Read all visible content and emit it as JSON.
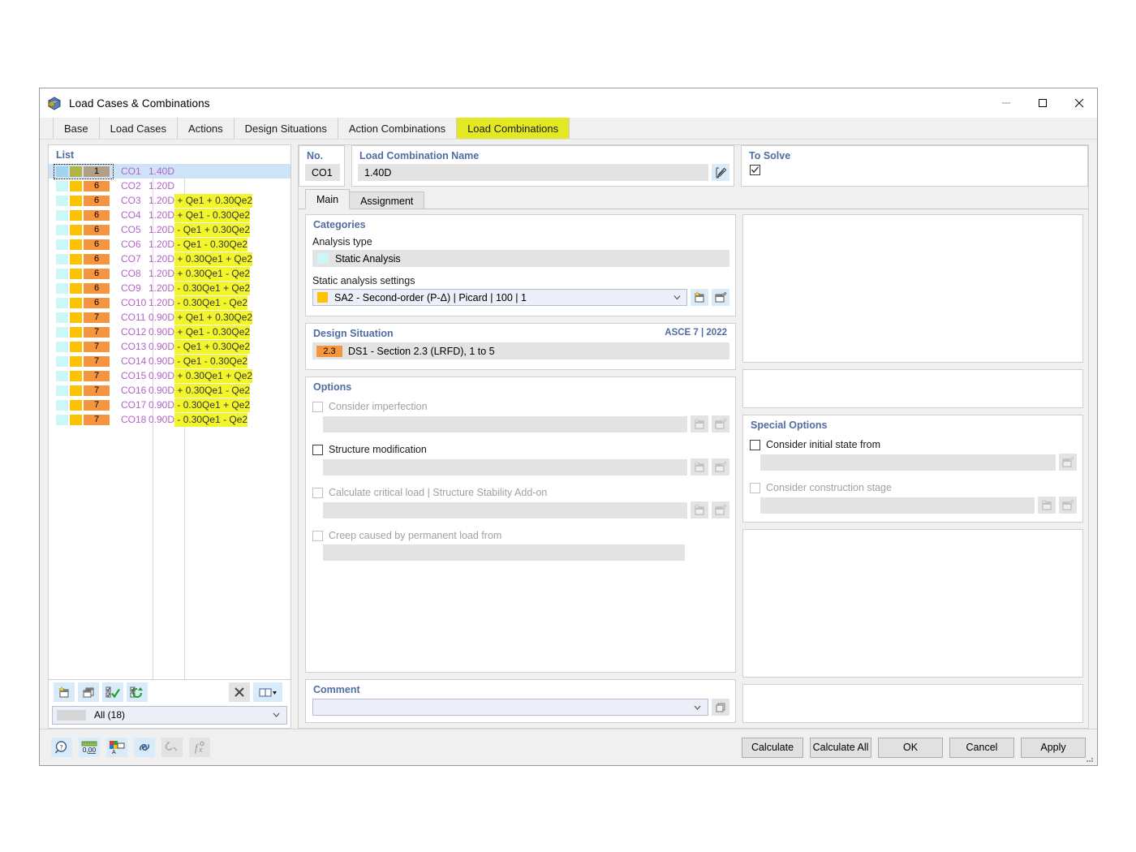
{
  "window": {
    "title": "Load Cases & Combinations",
    "minimize": "–",
    "maximize": "□",
    "close": "✕"
  },
  "tabs": [
    {
      "label": "Base",
      "active": false
    },
    {
      "label": "Load Cases",
      "active": false
    },
    {
      "label": "Actions",
      "active": false
    },
    {
      "label": "Design Situations",
      "active": false
    },
    {
      "label": "Action Combinations",
      "active": false
    },
    {
      "label": "Load Combinations",
      "active": true
    }
  ],
  "list": {
    "header": "List",
    "rows": [
      {
        "badge": "1",
        "no": "CO1",
        "base": "1.40D",
        "formula": "",
        "selected": true
      },
      {
        "badge": "6",
        "no": "CO2",
        "base": "1.20D",
        "formula": "",
        "selected": false
      },
      {
        "badge": "6",
        "no": "CO3",
        "base": "1.20D",
        "formula": "+ Qe1 + 0.30Qe2",
        "selected": false
      },
      {
        "badge": "6",
        "no": "CO4",
        "base": "1.20D",
        "formula": "+ Qe1 - 0.30Qe2",
        "selected": false
      },
      {
        "badge": "6",
        "no": "CO5",
        "base": "1.20D",
        "formula": "- Qe1 + 0.30Qe2",
        "selected": false
      },
      {
        "badge": "6",
        "no": "CO6",
        "base": "1.20D",
        "formula": "- Qe1 - 0.30Qe2",
        "selected": false
      },
      {
        "badge": "6",
        "no": "CO7",
        "base": "1.20D",
        "formula": "+ 0.30Qe1 + Qe2",
        "selected": false
      },
      {
        "badge": "6",
        "no": "CO8",
        "base": "1.20D",
        "formula": "+ 0.30Qe1 - Qe2",
        "selected": false
      },
      {
        "badge": "6",
        "no": "CO9",
        "base": "1.20D",
        "formula": "- 0.30Qe1 + Qe2",
        "selected": false
      },
      {
        "badge": "6",
        "no": "CO10",
        "base": "1.20D",
        "formula": "- 0.30Qe1 - Qe2",
        "selected": false
      },
      {
        "badge": "7",
        "no": "CO11",
        "base": "0.90D",
        "formula": "+ Qe1 + 0.30Qe2",
        "selected": false
      },
      {
        "badge": "7",
        "no": "CO12",
        "base": "0.90D",
        "formula": "+ Qe1 - 0.30Qe2",
        "selected": false
      },
      {
        "badge": "7",
        "no": "CO13",
        "base": "0.90D",
        "formula": "- Qe1 + 0.30Qe2",
        "selected": false
      },
      {
        "badge": "7",
        "no": "CO14",
        "base": "0.90D",
        "formula": "- Qe1 - 0.30Qe2",
        "selected": false
      },
      {
        "badge": "7",
        "no": "CO15",
        "base": "0.90D",
        "formula": "+ 0.30Qe1 + Qe2",
        "selected": false
      },
      {
        "badge": "7",
        "no": "CO16",
        "base": "0.90D",
        "formula": "+ 0.30Qe1 - Qe2",
        "selected": false
      },
      {
        "badge": "7",
        "no": "CO17",
        "base": "0.90D",
        "formula": "- 0.30Qe1 + Qe2",
        "selected": false
      },
      {
        "badge": "7",
        "no": "CO18",
        "base": "0.90D",
        "formula": "- 0.30Qe1 - Qe2",
        "selected": false
      }
    ],
    "toolbar": {
      "new": "new-icon",
      "copy": "copy-icon",
      "select_all": "select-all-icon",
      "refresh_select": "refresh-selection-icon",
      "delete": "✕",
      "view": "columns-icon",
      "view_caret": "▾"
    },
    "filter": {
      "value": "All (18)"
    }
  },
  "detail": {
    "no": {
      "label": "No.",
      "value": "CO1"
    },
    "name": {
      "label": "Load Combination Name",
      "value": "1.40D",
      "edit_icon": "edit-icon"
    },
    "to_solve": {
      "label": "To Solve",
      "checked": true
    },
    "inner_tabs": [
      {
        "label": "Main",
        "active": true
      },
      {
        "label": "Assignment",
        "active": false
      }
    ],
    "categories": {
      "title": "Categories",
      "analysis_type_label": "Analysis type",
      "analysis_type_value": "Static Analysis",
      "analysis_type_color": "#ccf7f7",
      "settings_label": "Static analysis settings",
      "settings_value": "SA2 - Second-order (P-Δ) | Picard | 100 | 1",
      "settings_color": "#fdc300",
      "new_icon": "new-icon",
      "edit_icon": "edit-icon"
    },
    "design_situation": {
      "title": "Design Situation",
      "standard": "ASCE 7 | 2022",
      "chip": "2.3",
      "value": "DS1 - Section 2.3 (LRFD), 1 to 5"
    },
    "options": {
      "title": "Options",
      "items": [
        {
          "label": "Consider imperfection",
          "checked": false,
          "enabled": false,
          "has_field": true,
          "buttons": 2
        },
        {
          "label": "Structure modification",
          "checked": false,
          "enabled": true,
          "has_field": true,
          "buttons": 2
        },
        {
          "label": "Calculate critical load | Structure Stability Add-on",
          "checked": false,
          "enabled": false,
          "has_field": true,
          "buttons": 2
        },
        {
          "label": "Creep caused by permanent load from",
          "checked": false,
          "enabled": false,
          "has_field": true,
          "buttons": 0
        }
      ]
    },
    "special_options": {
      "title": "Special Options",
      "items": [
        {
          "label": "Consider initial state from",
          "checked": false,
          "enabled": true,
          "buttons": 1
        },
        {
          "label": "Consider construction stage",
          "checked": false,
          "enabled": false,
          "buttons": 2
        }
      ]
    },
    "comment": {
      "title": "Comment",
      "value": "",
      "copy_icon": "copy-icon"
    }
  },
  "footer": {
    "icons": [
      {
        "name": "info-icon",
        "enabled": true
      },
      {
        "name": "units-icon",
        "enabled": true
      },
      {
        "name": "colors-icon",
        "enabled": true
      },
      {
        "name": "link-icon",
        "enabled": true
      },
      {
        "name": "relations-icon",
        "enabled": false
      },
      {
        "name": "formula-icon",
        "enabled": false
      }
    ],
    "buttons": [
      {
        "label": "Calculate"
      },
      {
        "label": "Calculate All"
      },
      {
        "label": "OK"
      },
      {
        "label": "Cancel"
      },
      {
        "label": "Apply"
      }
    ]
  }
}
